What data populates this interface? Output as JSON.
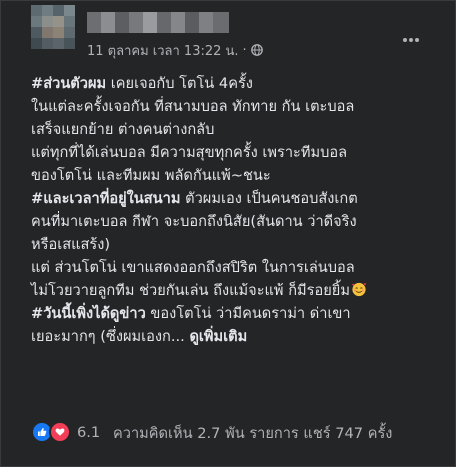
{
  "colors": {
    "card_bg": "#242526",
    "text_primary": "#e4e6eb",
    "text_secondary": "#b0b3b8",
    "like_blue": "#1877f2",
    "love_red": "#f33e58"
  },
  "post": {
    "timestamp": "11 ตุลาคม เวลา 13:22 น.",
    "separator": "·",
    "privacy_icon": "globe-icon",
    "more_icon": "more-horizontal-icon",
    "lines": [
      [
        {
          "text": "#ส่วนตัวผม",
          "bold": true
        },
        {
          "text": " เคยเจอกับ โตโน่ 4ครั้ง",
          "bold": false
        }
      ],
      [
        {
          "text": "ในแต่ละครั้งเจอกัน ที่สนามบอล ทักทาย กัน เตะบอล",
          "bold": false
        }
      ],
      [
        {
          "text": "เสร็จแยกย้าย ต่างคนต่างกลับ",
          "bold": false
        }
      ],
      [
        {
          "text": "แต่ทุกที่ได้เล่นบอล มีความสุขทุกครั้ง เพราะทีมบอล",
          "bold": false
        }
      ],
      [
        {
          "text": "ของโตโน่ และทีมผม พลัดกันแพ้~ชนะ",
          "bold": false
        }
      ],
      [
        {
          "text": "#และเวลาที่อยู่ในสนาม",
          "bold": true
        },
        {
          "text": " ตัวผมเอง เป็นคนชอบสังเกต",
          "bold": false
        }
      ],
      [
        {
          "text": "คนที่มาเตะบอล กีฬา จะบอกถึงนิสัย(สันดาน ว่าดีจริง",
          "bold": false
        }
      ],
      [
        {
          "text": "หรือเสแสร้ง)",
          "bold": false
        }
      ],
      [
        {
          "text": "แต่ ส่วนโตโน่ เขาแสดงออกถึงสปิริต ในการเล่นบอล",
          "bold": false
        }
      ],
      [
        {
          "text": "ไม่โวยวายลูกทีม ช่วยกันเล่น ถึงแม้จะแพ้ ก็มีรอยยิ้ม",
          "bold": false
        }
      ],
      [
        {
          "text": "#วันนี้เพิ่งได้ดูข่าว",
          "bold": true
        },
        {
          "text": " ของโตโน่ ว่ามีคนดราม่า ด่าเขา",
          "bold": false
        }
      ],
      [
        {
          "text": "เยอะมากๆ (ซึ่งผมเองก... ",
          "bold": false
        }
      ]
    ],
    "emoji": "smiling-face-with-hearts-emoji",
    "see_more": "ดูเพิ่มเติม"
  },
  "footer": {
    "reaction_icons": [
      "like-icon",
      "love-icon"
    ],
    "reaction_count": "6.1",
    "comments": "ความคิดเห็น 2.7 พัน รายการ",
    "shares": "แชร์ 747 ครั้ง"
  }
}
